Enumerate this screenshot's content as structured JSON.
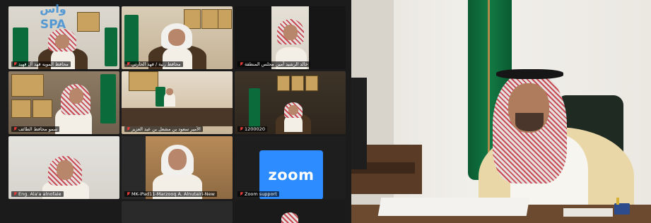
{
  "watermark": {
    "text": "واس SPA"
  },
  "tiles": [
    {
      "name": "محافظ المويه فهد آل فهيد",
      "active": true
    },
    {
      "name": "محافظ رنية / فهد الحارثي"
    },
    {
      "name": "خالد الرشيد أمين مجلس المنطقة"
    },
    {
      "name": "سمو محافظ الطائف"
    },
    {
      "name": "الأمير سعود بن مشعل بن عبد العزيز"
    },
    {
      "name": "1200020"
    },
    {
      "name": "Eng. Ala'a alnofaie"
    },
    {
      "name": "MK-iPad11-Marzooq A. Alnutairi-New"
    },
    {
      "name": "Zoom support",
      "logo": "zoom"
    }
  ],
  "colors": {
    "zoom_blue": "#2d8cff",
    "active_border": "#8bdc3a",
    "flag_green": "#0c6b3a"
  }
}
